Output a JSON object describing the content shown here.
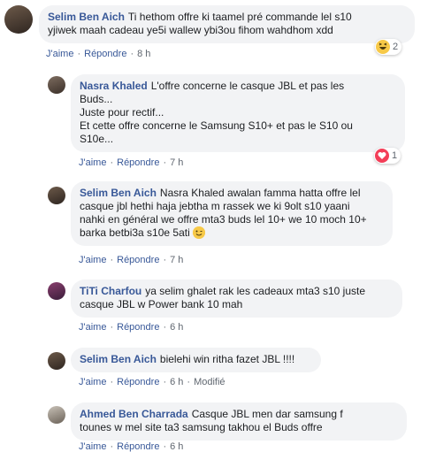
{
  "comments": [
    {
      "author": "Selim Ben Aich",
      "text": "Ti hethom offre ki taamel pré commande lel s10\nyjiwek maah cadeau ye5i wallew ybi3ou fihom wahdhom xdd",
      "like_label": "J'aime",
      "reply_label": "Répondre",
      "time": "8 h",
      "reaction_icon": "haha-emoji-icon",
      "reaction_count": "2"
    },
    {
      "author": "Nasra Khaled",
      "text": "L'offre concerne le casque JBL et pas les\nBuds...\nJuste pour rectif...\nEt cette offre concerne le Samsung S10+ et pas le S10 ou\nS10e...",
      "like_label": "J'aime",
      "reply_label": "Répondre",
      "time": "7 h",
      "reaction_icon": "love-heart-icon",
      "reaction_count": "1"
    },
    {
      "author": "Selim Ben Aich",
      "text": "Nasra Khaled awalan famma hatta offre lel\ncasque jbl hethi haja jebtha m rassek we ki 9olt s10 yaani\nnahki en général we offre mta3 buds lel 10+ we 10 moch 10+\nbarka betbi3a s10e 5ati",
      "text_emoji": "wink-emoji-icon",
      "like_label": "J'aime",
      "reply_label": "Répondre",
      "time": "7 h"
    },
    {
      "author": "TiTi Charfou",
      "text": "ya selim ghalet rak les cadeaux mta3 s10 juste\ncasque JBL w Power bank 10 mah",
      "like_label": "J'aime",
      "reply_label": "Répondre",
      "time": "6 h"
    },
    {
      "author": "Selim Ben Aich",
      "text": "bielehi win ritha fazet JBL !!!!",
      "like_label": "J'aime",
      "reply_label": "Répondre",
      "time": "6 h",
      "edited_label": "Modifié"
    },
    {
      "author": "Ahmed Ben Charrada",
      "text": "Casque JBL men dar samsung f\ntounes w mel site ta3 samsung takhou el Buds offre",
      "like_label": "J'aime",
      "reply_label": "Répondre",
      "time": "6 h"
    }
  ],
  "colors": {
    "author": "#385898",
    "bubble": "#f2f3f5",
    "meta": "#606770",
    "love": "#f33e58",
    "haha": "#f7c948"
  }
}
